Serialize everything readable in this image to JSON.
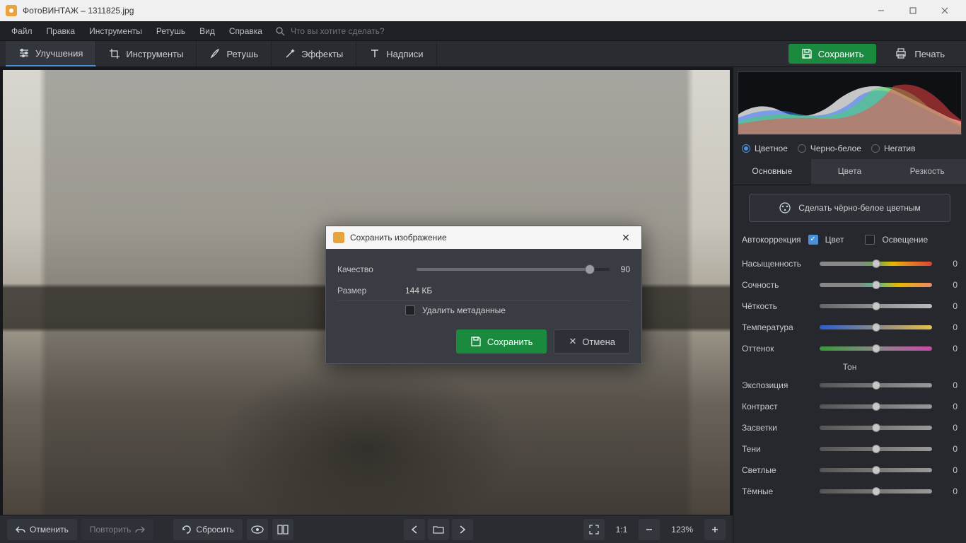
{
  "app": {
    "name": "ФотоВИНТАЖ",
    "file": "1311825.jpg",
    "title": "ФотоВИНТАЖ – 1311825.jpg"
  },
  "menubar": {
    "file": "Файл",
    "edit": "Правка",
    "tools": "Инструменты",
    "retouch": "Ретушь",
    "view": "Вид",
    "help": "Справка",
    "search_placeholder": "Что вы хотите сделать?"
  },
  "toolbar": {
    "enhance": "Улучшения",
    "tools": "Инструменты",
    "retouch": "Ретушь",
    "effects": "Эффекты",
    "text": "Надписи",
    "save": "Сохранить",
    "print": "Печать"
  },
  "bottombar": {
    "undo": "Отменить",
    "redo": "Повторить",
    "reset": "Сбросить",
    "zoom_ratio": "1:1",
    "zoom_pct": "123%"
  },
  "side": {
    "modes": {
      "color": "Цветное",
      "bw": "Черно-белое",
      "neg": "Негатив"
    },
    "tabs": {
      "basic": "Основные",
      "colors": "Цвета",
      "sharp": "Резкость"
    },
    "colorize": "Сделать чёрно-белое цветным",
    "autocorr": "Автокоррекция",
    "auto_color": "Цвет",
    "auto_light": "Освещение",
    "section_tone": "Тон",
    "sliders": {
      "saturation": {
        "label": "Насыщенность",
        "value": "0"
      },
      "vibrance": {
        "label": "Сочность",
        "value": "0"
      },
      "clarity": {
        "label": "Чёткость",
        "value": "0"
      },
      "temperature": {
        "label": "Температура",
        "value": "0"
      },
      "tint": {
        "label": "Оттенок",
        "value": "0"
      },
      "exposure": {
        "label": "Экспозиция",
        "value": "0"
      },
      "contrast": {
        "label": "Контраст",
        "value": "0"
      },
      "highlights": {
        "label": "Засветки",
        "value": "0"
      },
      "shadows": {
        "label": "Тени",
        "value": "0"
      },
      "whites": {
        "label": "Светлые",
        "value": "0"
      },
      "blacks": {
        "label": "Тёмные",
        "value": "0"
      }
    }
  },
  "dialog": {
    "title": "Сохранить изображение",
    "quality_label": "Качество",
    "quality_value": "90",
    "quality_pct": 90,
    "size_label": "Размер",
    "size_value": "144 КБ",
    "delete_meta": "Удалить метаданные",
    "save": "Сохранить",
    "cancel": "Отмена"
  }
}
